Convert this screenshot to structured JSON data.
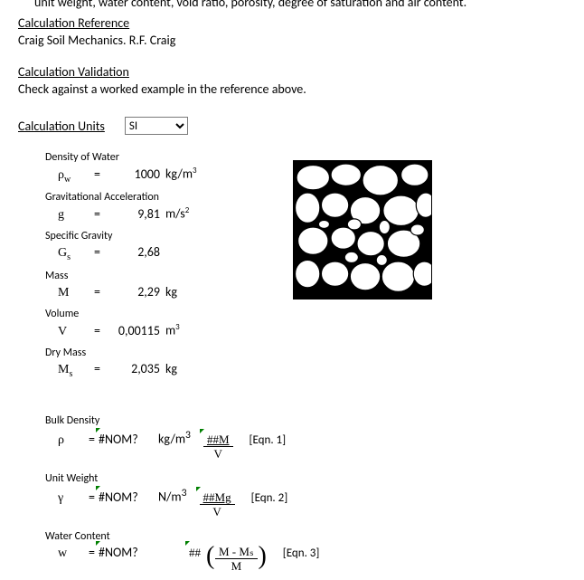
{
  "top_truncated": "unit weight, water content, void ratio, porosity, degree of saturation and air content.",
  "headings": {
    "calc_ref": "Calculation Reference",
    "calc_ref_text": "Craig Soil Mechanics. R.F. Craig",
    "calc_val": "Calculation Validation",
    "calc_val_text": "Check against a worked example in the reference above.",
    "calc_units": "Calculation Units"
  },
  "units_select": {
    "value": "SI",
    "options": [
      "SI"
    ]
  },
  "params": {
    "density_water": {
      "label": "Density of Water",
      "sym": "ρ",
      "sub": "w",
      "val": "1000",
      "unit_base": "kg/m",
      "unit_sup": "3"
    },
    "grav_accel": {
      "label": "Gravitational Acceleration",
      "sym": "g",
      "sub": "",
      "val": "9,81",
      "unit_base": "m/s",
      "unit_sup": "2"
    },
    "spec_grav": {
      "label": "Specific Gravity",
      "sym": "G",
      "sub": "s",
      "val": "2,68",
      "unit_base": "",
      "unit_sup": ""
    },
    "mass": {
      "label": "Mass",
      "sym": "M",
      "sub": "",
      "val": "2,29",
      "unit_base": "kg",
      "unit_sup": ""
    },
    "volume": {
      "label": "Volume",
      "sym": "V",
      "sub": "",
      "val": "0,00115",
      "unit_base": "m",
      "unit_sup": "3"
    },
    "dry_mass": {
      "label": "Dry Mass",
      "sym": "M",
      "sub": "s",
      "val": "2,035",
      "unit_base": "kg",
      "unit_sup": ""
    }
  },
  "results": {
    "bulk_density": {
      "label": "Bulk Density",
      "sym": "ρ",
      "sub": "",
      "val": "#NOM?",
      "unit_base": "kg/m",
      "unit_sup": "3",
      "frac_top": "##M",
      "frac_bot": "V",
      "eqn": "[Eqn. 1]"
    },
    "unit_weight": {
      "label": "Unit Weight",
      "sym": "γ",
      "sub": "",
      "val": "#NOM?",
      "unit_base": "N/m",
      "unit_sup": "3",
      "frac_top": "##Mg",
      "frac_bot": "V",
      "eqn": "[Eqn. 2]"
    },
    "water_content": {
      "label": "Water Content",
      "sym": "w",
      "sub": "",
      "val": "#NOM?",
      "unit_base": "",
      "unit_sup": "",
      "frac_top_prefix": "##",
      "frac_top": "M - Mₛ",
      "frac_bot": "M",
      "eqn": "[Eqn. 3]"
    }
  }
}
